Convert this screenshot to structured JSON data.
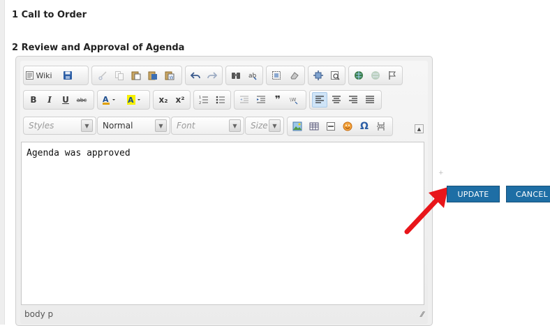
{
  "headings": {
    "item1": "1 Call to Order",
    "item2": "2 Review and Approval of Agenda"
  },
  "toolbar": {
    "wiki_label": "Wiki",
    "styles_combo": "Styles",
    "format_combo": "Normal",
    "font_combo": "Font",
    "size_combo": "Size",
    "superscript_label": "x²",
    "subscript_label": "x₂"
  },
  "editor": {
    "content": "Agenda was approved",
    "element_path": "body  p"
  },
  "actions": {
    "update_label": "UPDATE",
    "cancel_label": "CANCEL"
  },
  "colors": {
    "action_button": "#1e6ea5",
    "arrow": "#e8151a"
  },
  "icons": {
    "row1": [
      "wiki-icon",
      "save-icon",
      "cut-icon",
      "copy-icon",
      "paste-icon",
      "paste-text-icon",
      "paste-word-icon",
      "undo-icon",
      "redo-icon",
      "find-icon",
      "replace-icon",
      "select-all-icon",
      "remove-format-icon",
      "maximize-icon",
      "preview-icon",
      "link-icon",
      "unlink-icon",
      "anchor-icon"
    ],
    "row2": [
      "bold-icon",
      "italic-icon",
      "underline-icon",
      "strike-icon",
      "text-color-icon",
      "bg-color-icon",
      "subscript-icon",
      "superscript-icon",
      "numbered-list-icon",
      "bullet-list-icon",
      "outdent-icon",
      "indent-icon",
      "blockquote-icon",
      "source-icon",
      "align-left-icon",
      "align-center-icon",
      "align-right-icon",
      "justify-icon"
    ],
    "row3": [
      "image-icon",
      "table-icon",
      "horizontal-rule-icon",
      "smiley-icon",
      "special-char-icon",
      "page-break-icon"
    ]
  }
}
